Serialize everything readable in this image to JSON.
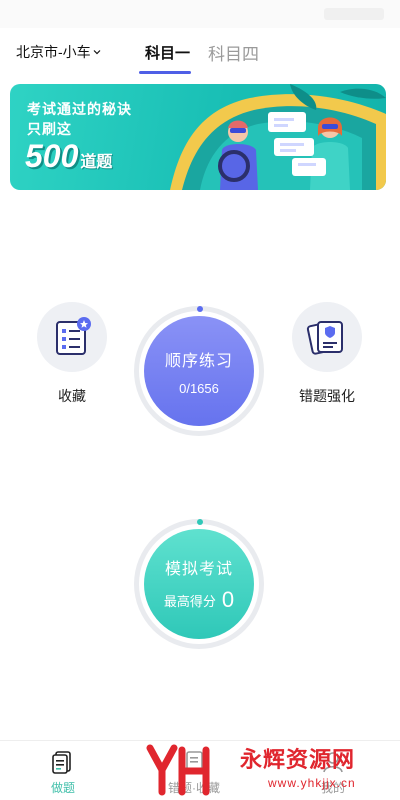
{
  "header": {
    "city": "北京市-小车",
    "tabs": [
      {
        "label": "科目一",
        "active": true
      },
      {
        "label": "科目四",
        "active": false
      }
    ]
  },
  "banner": {
    "line1": "考试通过的秘诀",
    "line2": "只刷这",
    "big_number": "500",
    "unit": "道题"
  },
  "main": {
    "favorites": {
      "label": "收藏",
      "icon": "checklist-star-icon"
    },
    "practice": {
      "title": "顺序练习",
      "progress": "0/1656"
    },
    "wrong": {
      "label": "错题强化",
      "icon": "cards-stack-icon"
    },
    "exam": {
      "title": "模拟考试",
      "score_label": "最高得分",
      "score_value": "0"
    }
  },
  "tabbar": {
    "items": [
      {
        "label": "做题",
        "icon": "document-icon",
        "active": true
      },
      {
        "label": "错题·收藏",
        "icon": "book-icon",
        "active": false
      },
      {
        "label": "我的",
        "icon": "user-icon",
        "active": false
      }
    ]
  },
  "watermark": {
    "logo_text": "YH",
    "title": "永辉资源网",
    "url": "www.yhkjjx.cn"
  },
  "colors": {
    "accent": "#4f5fe6",
    "practice": "#6f7af1",
    "exam": "#38cfbe",
    "tab_active": "#3fbfa9",
    "banner": "#1fc4b9"
  }
}
